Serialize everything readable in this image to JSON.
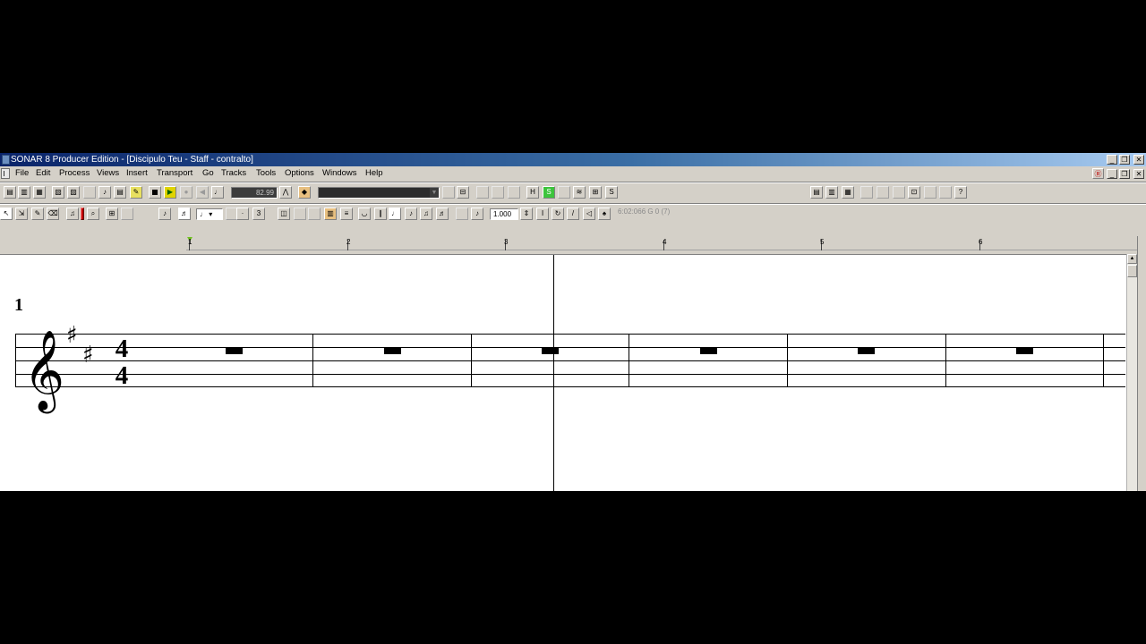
{
  "window": {
    "title": "SONAR 8 Producer Edition - [Discipulo Teu - Staff - contralto]",
    "controls": [
      "_",
      "❐",
      "✕"
    ],
    "doc_controls": [
      "_",
      "❐",
      "✕"
    ]
  },
  "menu": {
    "items": [
      {
        "key": "file",
        "label": "File"
      },
      {
        "key": "edit",
        "label": "Edit"
      },
      {
        "key": "process",
        "label": "Process"
      },
      {
        "key": "views",
        "label": "Views"
      },
      {
        "key": "insert",
        "label": "Insert"
      },
      {
        "key": "transport",
        "label": "Transport"
      },
      {
        "key": "go",
        "label": "Go"
      },
      {
        "key": "tracks",
        "label": "Tracks"
      },
      {
        "key": "tools",
        "label": "Tools"
      },
      {
        "key": "options",
        "label": "Options"
      },
      {
        "key": "windows",
        "label": "Windows"
      },
      {
        "key": "help",
        "label": "Help"
      }
    ]
  },
  "transport": {
    "time_display": "82.99",
    "loop_button_label": "S",
    "punch_button_label": "H"
  },
  "staff_toolbar": {
    "snap_value": "1.000",
    "position_readout": "6:02:066  G 0 (7)"
  },
  "ruler": {
    "measures": [
      "1",
      "2",
      "3",
      "4",
      "5",
      "6"
    ]
  },
  "score": {
    "measure_number": "1",
    "clef": "treble",
    "key_signature": "D major (2 sharps)",
    "time_signature": {
      "top": "4",
      "bottom": "4"
    },
    "measures": [
      {
        "number": 1,
        "content": "whole rest"
      },
      {
        "number": 2,
        "content": "whole rest"
      },
      {
        "number": 3,
        "content": "whole rest"
      },
      {
        "number": 4,
        "content": "whole rest"
      },
      {
        "number": 5,
        "content": "whole rest"
      },
      {
        "number": 6,
        "content": "whole rest"
      }
    ],
    "now_time_measure": 3.3
  },
  "icons": [
    "app-icon",
    "doc-icon",
    "play-icon",
    "stop-icon",
    "help-icon",
    "select-tool-icon",
    "draw-tool-icon",
    "erase-tool-icon",
    "zoom-tool-icon",
    "note-duration-icon",
    "scroll-up-arrow-icon"
  ]
}
